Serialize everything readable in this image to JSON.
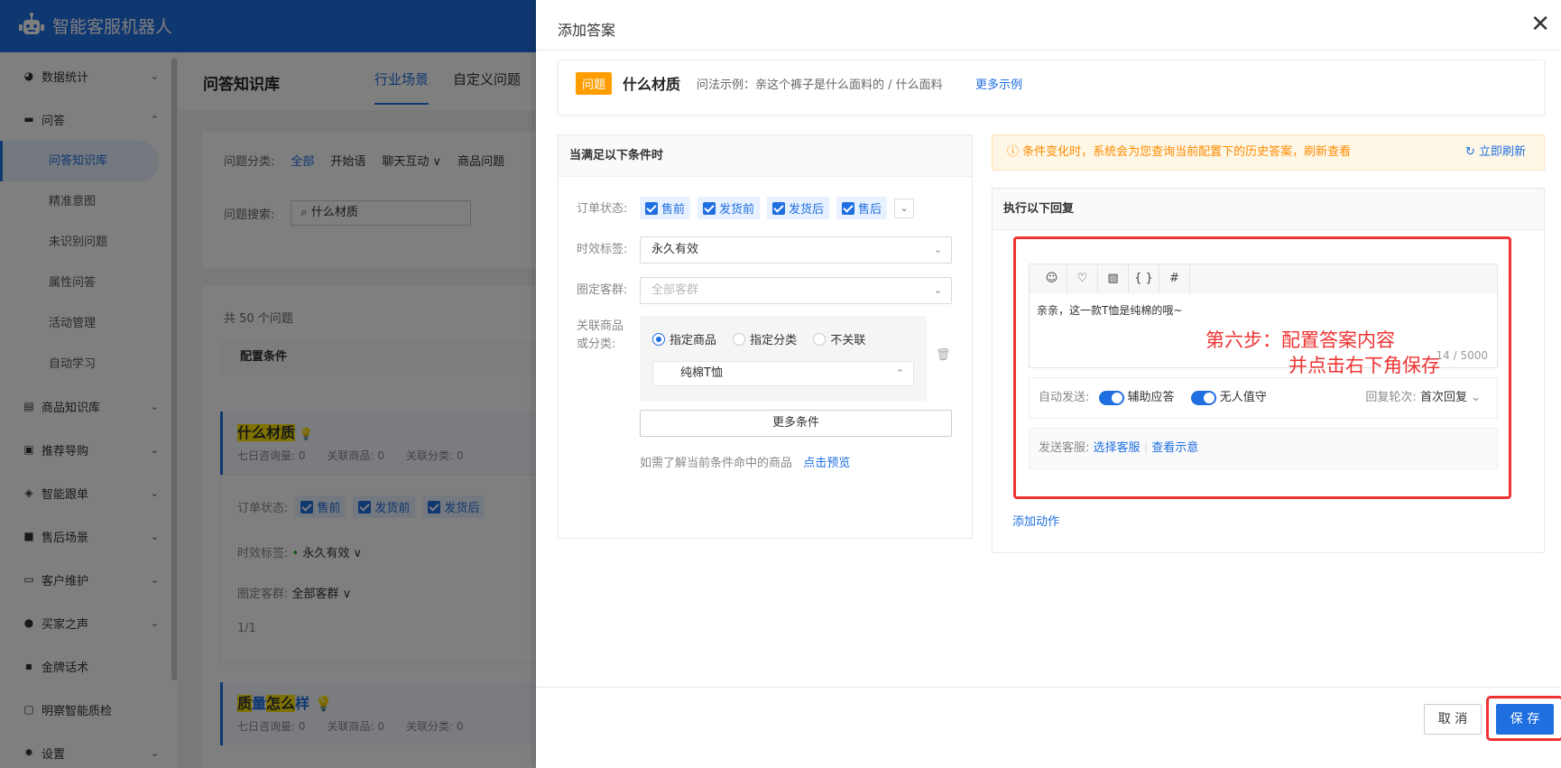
{
  "app": {
    "title": "智能客服机器人"
  },
  "sidebar": {
    "items": [
      {
        "label": "数据统计",
        "icon": "pie-chart-icon"
      },
      {
        "label": "问答",
        "icon": "chat-icon"
      },
      {
        "label": "商品知识库",
        "icon": "doc-icon"
      },
      {
        "label": "推荐导购",
        "icon": "recommend-icon"
      },
      {
        "label": "智能跟单",
        "icon": "layers-icon"
      },
      {
        "label": "售后场景",
        "icon": "truck-icon"
      },
      {
        "label": "客户维护",
        "icon": "card-icon"
      },
      {
        "label": "买家之声",
        "icon": "voice-icon"
      },
      {
        "label": "金牌话术",
        "icon": "message-icon"
      },
      {
        "label": "明察智能质检",
        "icon": "inspect-icon"
      },
      {
        "label": "设置",
        "icon": "gear-icon"
      }
    ],
    "sub_items": [
      "问答知识库",
      "精准意图",
      "未识别问题",
      "属性问答",
      "活动管理",
      "自动学习"
    ]
  },
  "main": {
    "title": "问答知识库",
    "tabs": [
      "行业场景",
      "自定义问题"
    ],
    "filter_label": "问题分类:",
    "filters": [
      "全部",
      "开始语",
      "聊天互动 ∨",
      "商品问题"
    ],
    "search_label": "问题搜索:",
    "search_value": "什么材质",
    "count_text": "共 50 个问题",
    "col_header": "配置条件",
    "q1": {
      "title": "什么材质",
      "stats": [
        "七日咨询量: 0",
        "关联商品: 0",
        "关联分类: 0"
      ],
      "order_label": "订单状态:",
      "order_tags": [
        "售前",
        "发货前",
        "发货后"
      ],
      "time_label": "时效标签:",
      "time_value": "永久有效 ∨",
      "group_label": "圈定客群:",
      "group_value": "全部客群 ∨",
      "page": "1/1"
    },
    "q2": {
      "title_a": "质",
      "title_b": "量",
      "title_c": "怎",
      "title_d": "么",
      "title_e": "样",
      "stats": [
        "七日咨询量: 0",
        "关联商品: 0",
        "关联分类: 0"
      ]
    }
  },
  "drawer": {
    "title": "添加答案",
    "question": {
      "badge": "问题",
      "title": "什么材质",
      "example": "问法示例：亲这个裤子是什么面料的 / 什么面料",
      "more": "更多示例"
    },
    "conditions": {
      "header": "当满足以下条件时",
      "order_label": "订单状态:",
      "order_tags": [
        "售前",
        "发货前",
        "发货后",
        "售后"
      ],
      "time_label": "时效标签:",
      "time_value": "永久有效",
      "group_label": "圈定客群:",
      "group_placeholder": "全部客群",
      "goods_label_1": "关联商品",
      "goods_label_2": "或分类:",
      "radios": [
        "指定商品",
        "指定分类",
        "不关联"
      ],
      "goods_value": "纯棉T恤",
      "more_btn": "更多条件",
      "hint": "如需了解当前条件命中的商品",
      "preview": "点击预览"
    },
    "tip": {
      "text": "ⓘ 条件变化时，系统会为您查询当前配置下的历史答案，刷新查看",
      "refresh": "立即刷新"
    },
    "reply": {
      "header": "执行以下回复",
      "content": "亲亲，这一款T恤是纯棉的哦~",
      "count": "14 / 5000",
      "auto_send_label": "自动发送:",
      "toggle1": "辅助应答",
      "toggle2": "无人值守",
      "round_label": "回复轮次:",
      "round_value": "首次回复",
      "send_label": "发送客服:",
      "choose": "选择客服",
      "view": "查看示意",
      "add_action": "添加动作"
    },
    "note_line1": "第六步：配置答案内容",
    "note_line2": "并点击右下角保存",
    "cancel": "取 消",
    "save": "保 存"
  }
}
